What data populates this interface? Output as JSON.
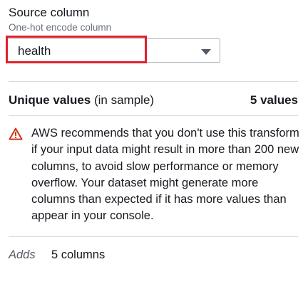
{
  "source_column": {
    "label": "Source column",
    "description": "One-hot encode column",
    "selected_value": "health"
  },
  "unique_values": {
    "title_bold": "Unique values",
    "title_suffix": " (in sample)",
    "count": "5 values"
  },
  "warning": {
    "icon": "warning-triangle-icon",
    "color": "#d13212",
    "text": "AWS recommends that you don't use this transform if your input data might result in more than 200 new columns, to avoid slow performance or memory overflow. Your dataset might generate more columns than expected if it has more values than appear in your console."
  },
  "adds": {
    "label": "Adds",
    "value": "5 columns"
  },
  "colors": {
    "highlight": "#e0202b",
    "divider": "#d5dbdb"
  }
}
